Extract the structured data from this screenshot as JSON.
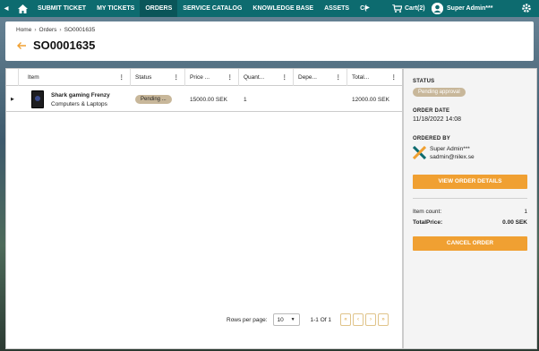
{
  "nav": {
    "items": [
      {
        "label": "SUBMIT TICKET"
      },
      {
        "label": "MY TICKETS"
      },
      {
        "label": "ORDERS",
        "active": true
      },
      {
        "label": "SERVICE CATALOG"
      },
      {
        "label": "KNOWLEDGE BASE"
      },
      {
        "label": "ASSETS"
      },
      {
        "label": "C("
      }
    ],
    "cart_label": "Cart(2)",
    "user_name": "Super Admin***",
    "colors": {
      "bar": "#0d6b6f",
      "active": "#0a5559"
    }
  },
  "breadcrumb": {
    "home": "Home",
    "orders": "Orders",
    "current": "SO0001635"
  },
  "page_title": "SO0001635",
  "table": {
    "columns": [
      "Item",
      "Status",
      "Price ...",
      "Quant...",
      "Depe...",
      "Total..."
    ],
    "rows": [
      {
        "name": "Shark gaming Frenzy",
        "category": "Computers & Laptops",
        "status": "Pending ...",
        "price": "15000.00 SEK",
        "quantity": "1",
        "depends": "",
        "total": "12000.00 SEK"
      }
    ]
  },
  "pagination": {
    "rows_per_page_label": "Rows per page:",
    "rows_per_page": "10",
    "range": "1-1 Of 1"
  },
  "side": {
    "status_label": "STATUS",
    "status": "Pending approval",
    "order_date_label": "ORDER DATE",
    "order_date": "11/18/2022 14:08",
    "ordered_by_label": "ORDERED BY",
    "orderer_name": "Super Admin***",
    "orderer_email": "sadmin@nilex.se",
    "view_details_label": "VIEW ORDER DETAILS",
    "item_count_label": "Item count:",
    "item_count": "1",
    "total_price_label": "TotalPrice:",
    "total_price": "0.00 SEK",
    "cancel_label": "CANCEL ORDER",
    "colors": {
      "accent": "#f0a032",
      "badge": "#c8b79a"
    }
  }
}
